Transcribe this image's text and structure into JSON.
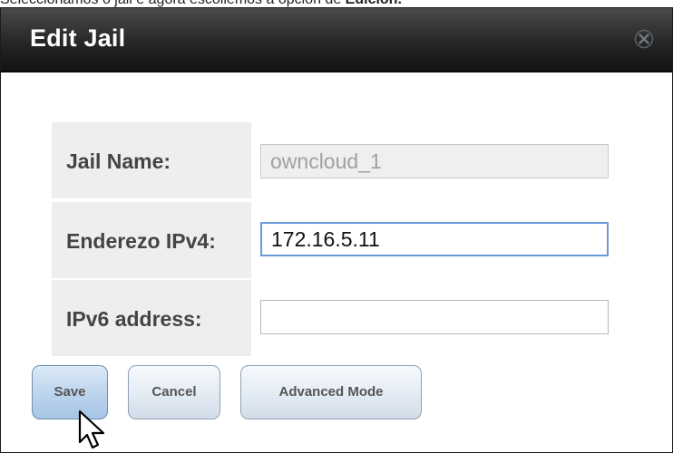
{
  "caption": {
    "text": "Seleccionamos o jail e agora escollemos a opción de ",
    "bold": "Edición."
  },
  "dialog": {
    "title": "Edit Jail",
    "close_icon": "close-icon"
  },
  "form": {
    "rows": [
      {
        "label": "Jail Name:",
        "value": "owncloud_1",
        "state": "disabled"
      },
      {
        "label": "Enderezo IPv4:",
        "value": "172.16.5.11",
        "state": "focused"
      },
      {
        "label": "IPv6 address:",
        "value": "",
        "state": "enabled"
      }
    ]
  },
  "buttons": {
    "save": "Save",
    "cancel": "Cancel",
    "advanced": "Advanced Mode"
  },
  "cursor_icon": "arrow-cursor-icon"
}
